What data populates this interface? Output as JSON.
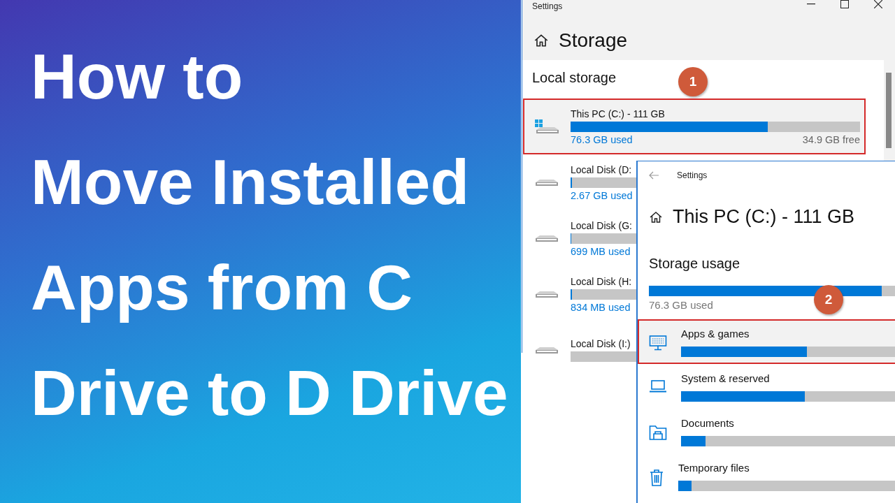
{
  "title_lines": [
    "How to",
    "Move Installed",
    "Apps from C",
    "Drive to D Drive"
  ],
  "storage_window": {
    "title": "Settings",
    "heading": "Storage",
    "section": "Local storage",
    "step": "1",
    "drives": [
      {
        "kind": "system",
        "name": "This PC (C:) - 111 GB",
        "used": "76.3 GB used",
        "free": "34.9 GB free",
        "level": 0.68,
        "highlighted": true
      },
      {
        "kind": "disk",
        "name": "Local Disk (D:",
        "used": "2.67 GB used",
        "level": 0.02,
        "highlighted": false
      },
      {
        "kind": "disk",
        "name": "Local Disk (G:",
        "used": "699 MB used",
        "level": 0.01,
        "highlighted": false
      },
      {
        "kind": "disk",
        "name": "Local Disk (H:",
        "used": "834 MB used",
        "level": 0.02,
        "highlighted": false
      },
      {
        "kind": "disk",
        "name": "Local Disk (I:)",
        "highlighted": false
      }
    ]
  },
  "drive_window": {
    "title": "Settings",
    "heading": "This PC (C:) - 111 GB",
    "section": "Storage usage",
    "level": 0.92,
    "used": "76.3 GB used",
    "step": "2",
    "categories": [
      {
        "kind": "apps",
        "name": "Apps & games",
        "level": 0.57,
        "highlighted": true
      },
      {
        "kind": "system",
        "name": "System & reserved",
        "level": 0.56,
        "highlighted": false
      },
      {
        "kind": "documents",
        "name": "Documents",
        "level": 0.11,
        "highlighted": false
      },
      {
        "kind": "temp",
        "name": "Temporary files",
        "level": 0.06,
        "highlighted": false
      }
    ]
  }
}
